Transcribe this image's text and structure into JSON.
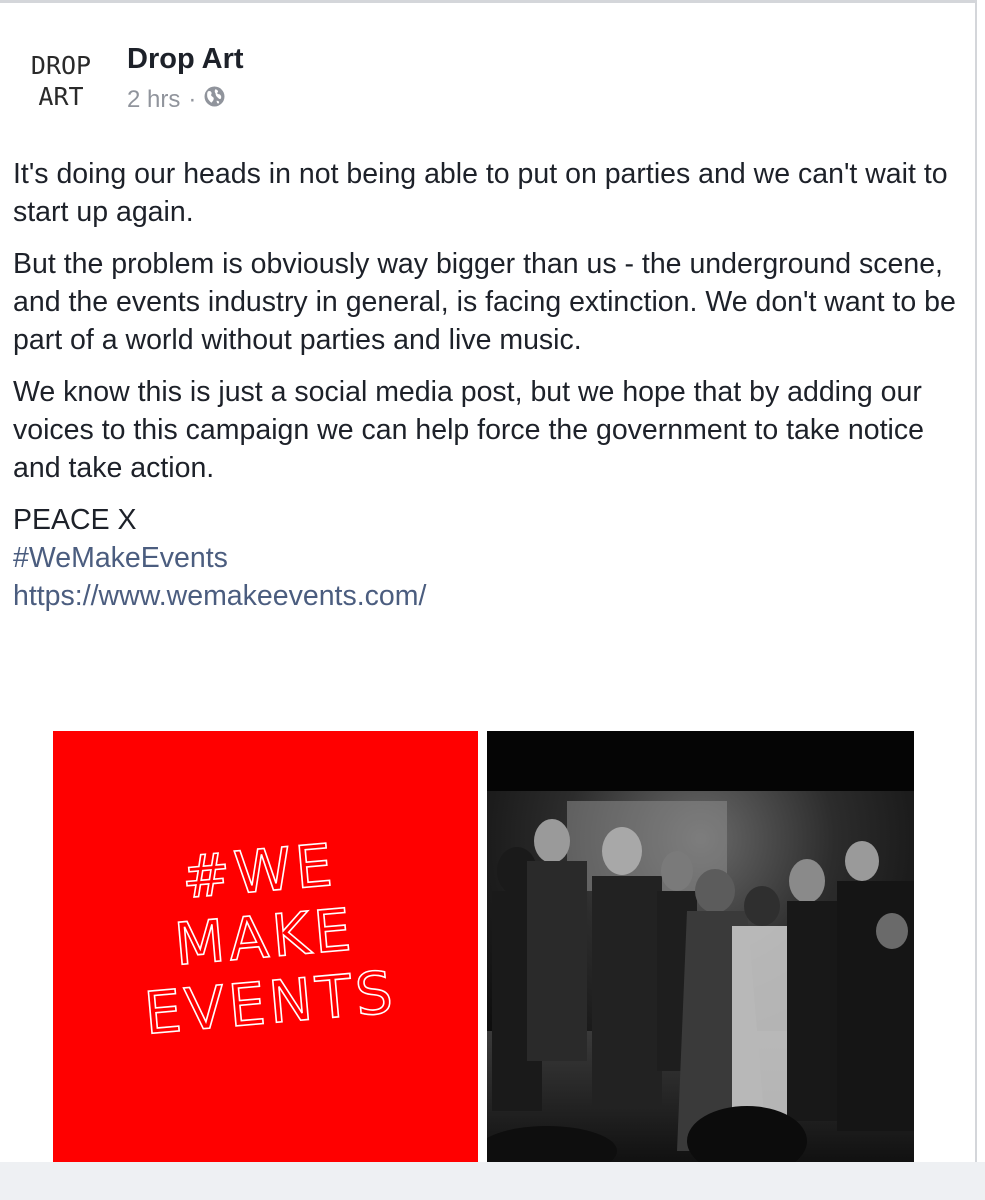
{
  "post": {
    "author_avatar_line1": "DROP",
    "author_avatar_line2": "ART",
    "author_name": "Drop Art",
    "timestamp": "2 hrs",
    "separator": "·",
    "privacy_icon": "globe-icon",
    "paragraphs": [
      "It's doing our heads in not being able to put on parties and we can't wait to start up again.",
      "But the problem is obviously way bigger than us - the underground scene, and the events industry in general, is facing extinction. We don't want to be part of a world without parties and live music.",
      "We know this is just a social media post, but we hope that by adding our voices to this campaign we can help force the government to take notice and take action."
    ],
    "signoff": "PEACE X",
    "hashtag": "#WeMakeEvents",
    "link": "https://www.wemakeevents.com/",
    "image1_text": [
      "#WE",
      "MAKE",
      "EVENTS"
    ],
    "colors": {
      "text": "#1d2129",
      "meta": "#90949c",
      "link": "#4b5d7f",
      "campaign_red": "#ff0000"
    }
  }
}
